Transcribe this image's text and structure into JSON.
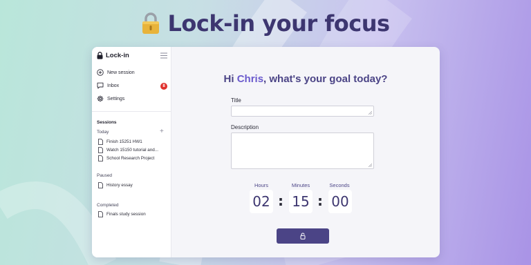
{
  "hero": {
    "title": "Lock-in your focus",
    "icon": "lock-icon"
  },
  "app": {
    "name": "Lock-in"
  },
  "sidebar": {
    "nav": [
      {
        "label": "New session",
        "icon": "plus-circle-icon"
      },
      {
        "label": "Inbox",
        "icon": "message-icon",
        "badge": "8"
      },
      {
        "label": "Settings",
        "icon": "gear-icon"
      }
    ],
    "sessions_title": "Sessions",
    "groups": [
      {
        "title": "Today",
        "items": [
          "Finish 15251 HW1",
          "Watch 15150 tutorial and...",
          "School Research Project"
        ]
      },
      {
        "title": "Paused",
        "items": [
          "History essay"
        ]
      },
      {
        "title": "Completed",
        "items": [
          "Finals study session"
        ]
      }
    ]
  },
  "main": {
    "greeting_prefix": "Hi ",
    "greeting_name": "Chris",
    "greeting_suffix": ", what's your goal today?",
    "title_label": "Title",
    "title_value": "",
    "description_label": "Description",
    "description_value": "",
    "timer": {
      "hours_label": "Hours",
      "hours": "02",
      "minutes_label": "Minutes",
      "minutes": "15",
      "seconds_label": "Seconds",
      "seconds": "00"
    },
    "start_button_icon": "lock-icon"
  },
  "colors": {
    "accent": "#4b4486",
    "name_highlight": "#6a5acd",
    "badge": "#e0322e"
  }
}
